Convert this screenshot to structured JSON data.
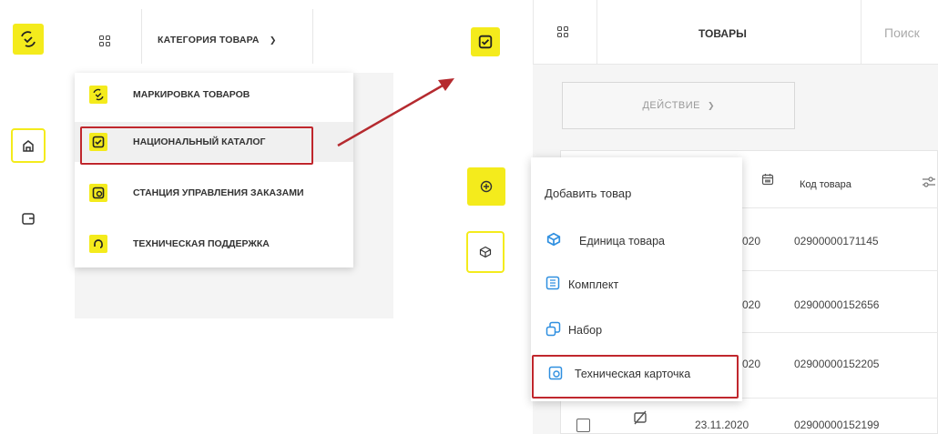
{
  "left_panel": {
    "category_label": "КАТЕГОРИЯ ТОВАРА",
    "menu": [
      {
        "label": "МАРКИРОВКА ТОВАРОВ",
        "icon": "check-dashed-icon"
      },
      {
        "label": "НАЦИОНАЛЬНЫЙ КАТАЛОГ",
        "icon": "checkbox-icon"
      },
      {
        "label": "СТАНЦИЯ УПРАВЛЕНИЯ ЗАКАЗАМИ",
        "icon": "station-icon"
      },
      {
        "label": "ТЕХНИЧЕСКАЯ ПОДДЕРЖКА",
        "icon": "support-icon"
      }
    ]
  },
  "right_panel": {
    "title": "ТОВАРЫ",
    "search_placeholder": "Поиск",
    "action_label": "ДЕЙСТВИЕ",
    "column_code": "Код товара",
    "rows": [
      {
        "date": "020",
        "code": "02900000171145"
      },
      {
        "date": "020",
        "code": "02900000152656"
      },
      {
        "date": "020",
        "code": "02900000152205"
      },
      {
        "date": "23.11.2020",
        "code": "02900000152199"
      }
    ],
    "popup": {
      "heading": "Добавить товар",
      "items": [
        {
          "label": "Единица товара",
          "icon": "cube-icon"
        },
        {
          "label": "Комплект",
          "icon": "list-box-icon"
        },
        {
          "label": "Набор",
          "icon": "set-icon"
        },
        {
          "label": "Техническая карточка",
          "icon": "tech-card-icon"
        }
      ]
    }
  },
  "colors": {
    "accent": "#f4eb1c",
    "highlight": "#c0272d",
    "icon_blue": "#2f8fe0"
  }
}
